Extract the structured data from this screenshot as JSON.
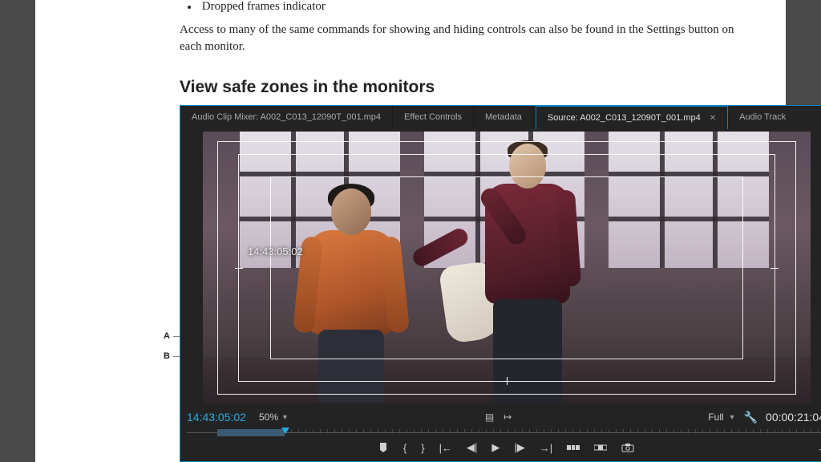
{
  "bullet": "Dropped frames indicator",
  "paragraph": "Access to many of the same commands for showing and hiding controls can also be found in the Settings button on each monitor.",
  "heading": "View safe zones in the monitors",
  "tabs": {
    "t0": "Audio Clip Mixer: A002_C013_12090T_001.mp4",
    "t1": "Effect Controls",
    "t2": "Metadata",
    "t3": "Source: A002_C013_12090T_001.mp4",
    "t4": "Audio Track"
  },
  "overlay_tc": "14:43:05:02",
  "callouts": {
    "a": "A",
    "b": "B"
  },
  "controls": {
    "current_tc": "14:43:05:02",
    "zoom_pct": "50%",
    "fit_label": "Full",
    "duration_tc": "00:00:21:04"
  },
  "chart_data": null
}
